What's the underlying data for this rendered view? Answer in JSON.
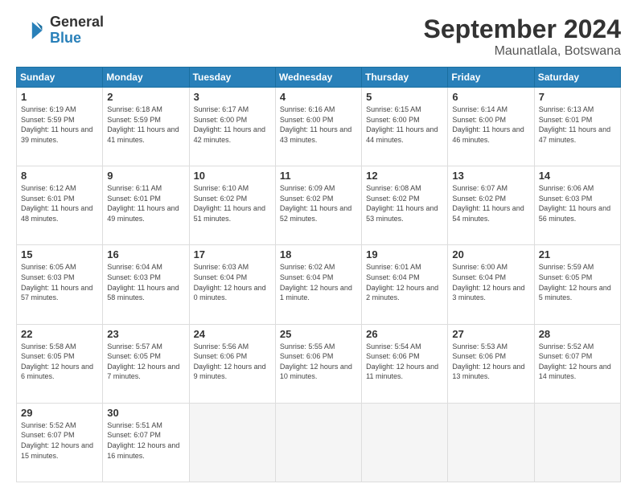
{
  "header": {
    "logo_general": "General",
    "logo_blue": "Blue",
    "title": "September 2024",
    "subtitle": "Maunatlala, Botswana"
  },
  "columns": [
    "Sunday",
    "Monday",
    "Tuesday",
    "Wednesday",
    "Thursday",
    "Friday",
    "Saturday"
  ],
  "weeks": [
    [
      {
        "day": "1",
        "info": "Sunrise: 6:19 AM\nSunset: 5:59 PM\nDaylight: 11 hours and 39 minutes."
      },
      {
        "day": "2",
        "info": "Sunrise: 6:18 AM\nSunset: 5:59 PM\nDaylight: 11 hours and 41 minutes."
      },
      {
        "day": "3",
        "info": "Sunrise: 6:17 AM\nSunset: 6:00 PM\nDaylight: 11 hours and 42 minutes."
      },
      {
        "day": "4",
        "info": "Sunrise: 6:16 AM\nSunset: 6:00 PM\nDaylight: 11 hours and 43 minutes."
      },
      {
        "day": "5",
        "info": "Sunrise: 6:15 AM\nSunset: 6:00 PM\nDaylight: 11 hours and 44 minutes."
      },
      {
        "day": "6",
        "info": "Sunrise: 6:14 AM\nSunset: 6:00 PM\nDaylight: 11 hours and 46 minutes."
      },
      {
        "day": "7",
        "info": "Sunrise: 6:13 AM\nSunset: 6:01 PM\nDaylight: 11 hours and 47 minutes."
      }
    ],
    [
      {
        "day": "8",
        "info": "Sunrise: 6:12 AM\nSunset: 6:01 PM\nDaylight: 11 hours and 48 minutes."
      },
      {
        "day": "9",
        "info": "Sunrise: 6:11 AM\nSunset: 6:01 PM\nDaylight: 11 hours and 49 minutes."
      },
      {
        "day": "10",
        "info": "Sunrise: 6:10 AM\nSunset: 6:02 PM\nDaylight: 11 hours and 51 minutes."
      },
      {
        "day": "11",
        "info": "Sunrise: 6:09 AM\nSunset: 6:02 PM\nDaylight: 11 hours and 52 minutes."
      },
      {
        "day": "12",
        "info": "Sunrise: 6:08 AM\nSunset: 6:02 PM\nDaylight: 11 hours and 53 minutes."
      },
      {
        "day": "13",
        "info": "Sunrise: 6:07 AM\nSunset: 6:02 PM\nDaylight: 11 hours and 54 minutes."
      },
      {
        "day": "14",
        "info": "Sunrise: 6:06 AM\nSunset: 6:03 PM\nDaylight: 11 hours and 56 minutes."
      }
    ],
    [
      {
        "day": "15",
        "info": "Sunrise: 6:05 AM\nSunset: 6:03 PM\nDaylight: 11 hours and 57 minutes."
      },
      {
        "day": "16",
        "info": "Sunrise: 6:04 AM\nSunset: 6:03 PM\nDaylight: 11 hours and 58 minutes."
      },
      {
        "day": "17",
        "info": "Sunrise: 6:03 AM\nSunset: 6:04 PM\nDaylight: 12 hours and 0 minutes."
      },
      {
        "day": "18",
        "info": "Sunrise: 6:02 AM\nSunset: 6:04 PM\nDaylight: 12 hours and 1 minute."
      },
      {
        "day": "19",
        "info": "Sunrise: 6:01 AM\nSunset: 6:04 PM\nDaylight: 12 hours and 2 minutes."
      },
      {
        "day": "20",
        "info": "Sunrise: 6:00 AM\nSunset: 6:04 PM\nDaylight: 12 hours and 3 minutes."
      },
      {
        "day": "21",
        "info": "Sunrise: 5:59 AM\nSunset: 6:05 PM\nDaylight: 12 hours and 5 minutes."
      }
    ],
    [
      {
        "day": "22",
        "info": "Sunrise: 5:58 AM\nSunset: 6:05 PM\nDaylight: 12 hours and 6 minutes."
      },
      {
        "day": "23",
        "info": "Sunrise: 5:57 AM\nSunset: 6:05 PM\nDaylight: 12 hours and 7 minutes."
      },
      {
        "day": "24",
        "info": "Sunrise: 5:56 AM\nSunset: 6:06 PM\nDaylight: 12 hours and 9 minutes."
      },
      {
        "day": "25",
        "info": "Sunrise: 5:55 AM\nSunset: 6:06 PM\nDaylight: 12 hours and 10 minutes."
      },
      {
        "day": "26",
        "info": "Sunrise: 5:54 AM\nSunset: 6:06 PM\nDaylight: 12 hours and 11 minutes."
      },
      {
        "day": "27",
        "info": "Sunrise: 5:53 AM\nSunset: 6:06 PM\nDaylight: 12 hours and 13 minutes."
      },
      {
        "day": "28",
        "info": "Sunrise: 5:52 AM\nSunset: 6:07 PM\nDaylight: 12 hours and 14 minutes."
      }
    ],
    [
      {
        "day": "29",
        "info": "Sunrise: 5:52 AM\nSunset: 6:07 PM\nDaylight: 12 hours and 15 minutes."
      },
      {
        "day": "30",
        "info": "Sunrise: 5:51 AM\nSunset: 6:07 PM\nDaylight: 12 hours and 16 minutes."
      },
      {
        "day": "",
        "info": ""
      },
      {
        "day": "",
        "info": ""
      },
      {
        "day": "",
        "info": ""
      },
      {
        "day": "",
        "info": ""
      },
      {
        "day": "",
        "info": ""
      }
    ]
  ]
}
